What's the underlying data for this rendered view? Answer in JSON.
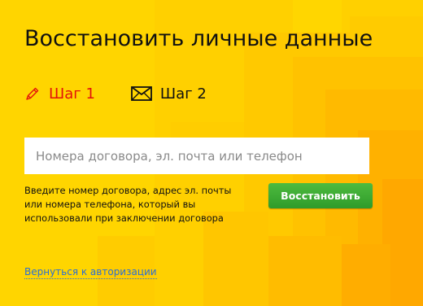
{
  "page": {
    "title": "Восстановить личные данные"
  },
  "steps": [
    {
      "label": "Шаг 1",
      "icon": "pencil-icon",
      "active": true
    },
    {
      "label": "Шаг 2",
      "icon": "envelope-icon",
      "active": false
    }
  ],
  "form": {
    "input_value": "",
    "input_placeholder": "Номера договора, эл. почта или телефон",
    "hint": "Введите номер договора, адрес эл. почты или номера телефона, который вы использовали при заключении договора",
    "submit_label": "Восстановить"
  },
  "footer": {
    "back_link_label": "Вернуться к авторизации"
  },
  "colors": {
    "background": "#ffd200",
    "active_step": "#e3120b",
    "button": "#3aa935",
    "link": "#2a6fd6"
  }
}
